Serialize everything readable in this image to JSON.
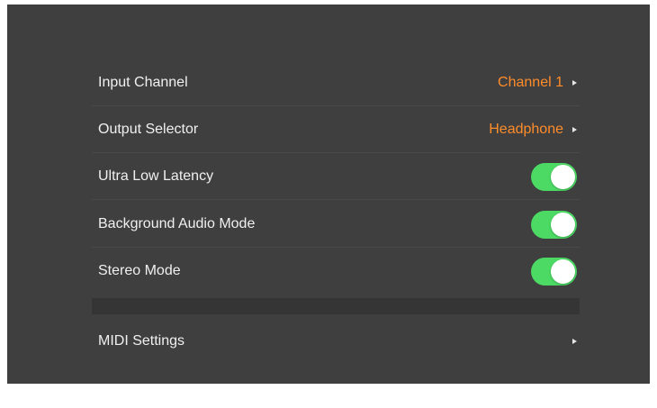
{
  "settings": {
    "rows": [
      {
        "label": "Input Channel",
        "value": "Channel 1",
        "kind": "picker"
      },
      {
        "label": "Output Selector",
        "value": "Headphone",
        "kind": "picker"
      },
      {
        "label": "Ultra Low Latency",
        "kind": "toggle",
        "on": true
      },
      {
        "label": "Background Audio Mode",
        "kind": "toggle",
        "on": true
      },
      {
        "label": "Stereo Mode",
        "kind": "toggle",
        "on": true
      }
    ],
    "midi": {
      "label": "MIDI Settings"
    }
  },
  "colors": {
    "panel": "#3f3f3f",
    "accent_orange": "#ff8c2a",
    "toggle_on": "#4cd964"
  }
}
